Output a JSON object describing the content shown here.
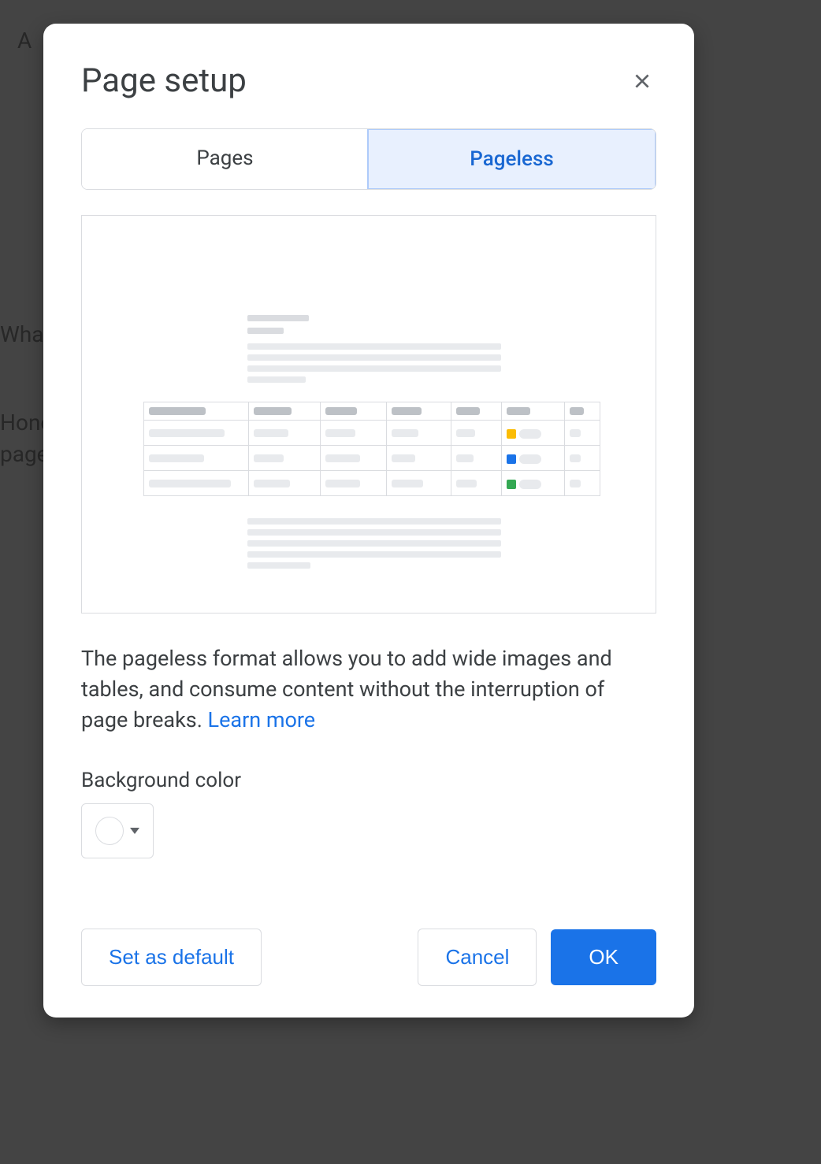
{
  "dialog": {
    "title": "Page setup",
    "tabs": {
      "pages": "Pages",
      "pageless": "Pageless"
    },
    "description": "The pageless format allows you to add wide images and tables, and consume content without the interruption of page breaks. ",
    "learn_more": "Learn more",
    "background_label": "Background color",
    "background_value": "#ffffff",
    "buttons": {
      "default": "Set as default",
      "cancel": "Cancel",
      "ok": "OK"
    }
  },
  "background": {
    "line1": "What",
    "line2a": "Honestly",
    "line2b": "page"
  }
}
